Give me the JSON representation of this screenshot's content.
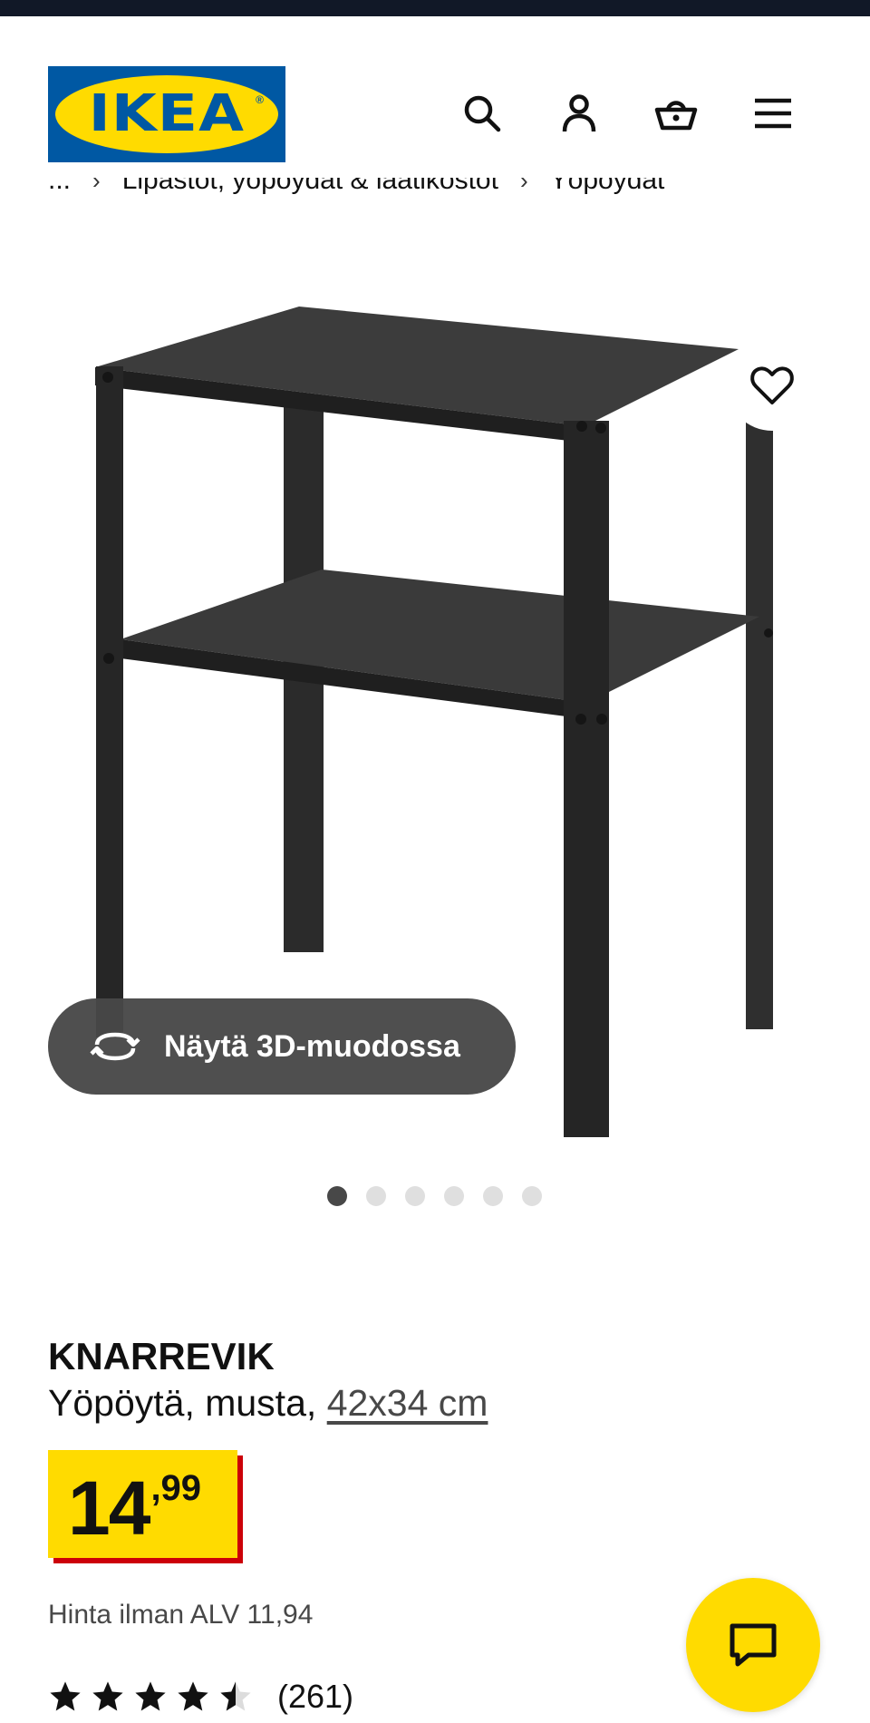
{
  "header": {
    "logo_text": "IKEA",
    "logo_reg": "®",
    "icons": [
      "search-icon",
      "account-icon",
      "basket-icon",
      "menu-icon"
    ]
  },
  "breadcrumb": {
    "items": [
      "...",
      "Lipastot, yöpöydät & laatikostot",
      "Yöpöydät"
    ],
    "separator": "›"
  },
  "media": {
    "view_3d_label": "Näytä 3D-muodossa",
    "image_count": 6,
    "active_index": 0
  },
  "product": {
    "name": "KNARREVIK",
    "description": "Yöpöytä, musta,",
    "size": "42x34 cm",
    "price_integer": "14",
    "price_decimal": ",99",
    "vat_text": "Hinta ilman ALV 11,94",
    "rating_value": 4.5,
    "rating_count": "(261)"
  },
  "colors": {
    "ikea_blue": "#0058a3",
    "ikea_yellow": "#ffdb00",
    "price_shadow_red": "#cc0008",
    "text_dark": "#111111",
    "text_gray": "#484848"
  }
}
